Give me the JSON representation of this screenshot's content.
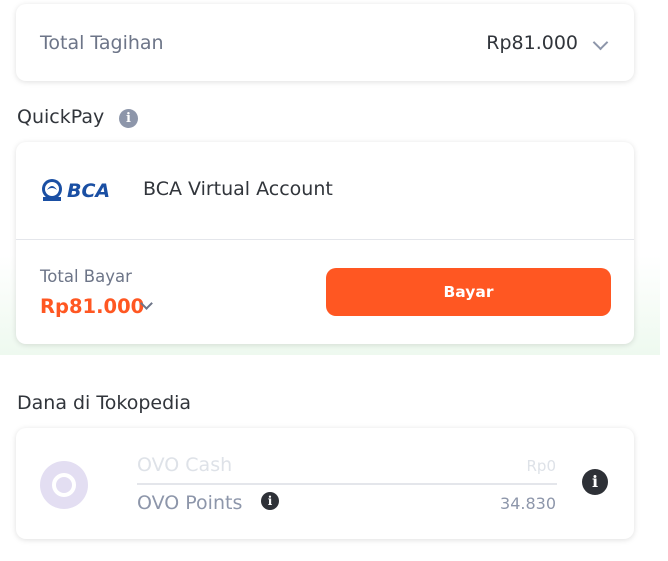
{
  "total_tagihan": {
    "label": "Total Tagihan",
    "amount": "Rp81.000"
  },
  "quickpay": {
    "title": "QuickPay",
    "method_name": "BCA Virtual Account",
    "logo_text": "BCA",
    "total_bayar_label": "Total Bayar",
    "total_bayar_amount": "Rp81.000",
    "pay_button": "Bayar"
  },
  "dana": {
    "title": "Dana di Tokopedia",
    "ovo_cash_label": "OVO Cash",
    "ovo_cash_value": "Rp0",
    "ovo_points_label": "OVO Points",
    "ovo_points_value": "34.830"
  },
  "colors": {
    "accent": "#ff5722",
    "bca_blue": "#1a4fa3",
    "text": "#31353b"
  },
  "icons": [
    "chevron-down-icon",
    "info-icon",
    "bca-logo",
    "ovo-logo"
  ]
}
